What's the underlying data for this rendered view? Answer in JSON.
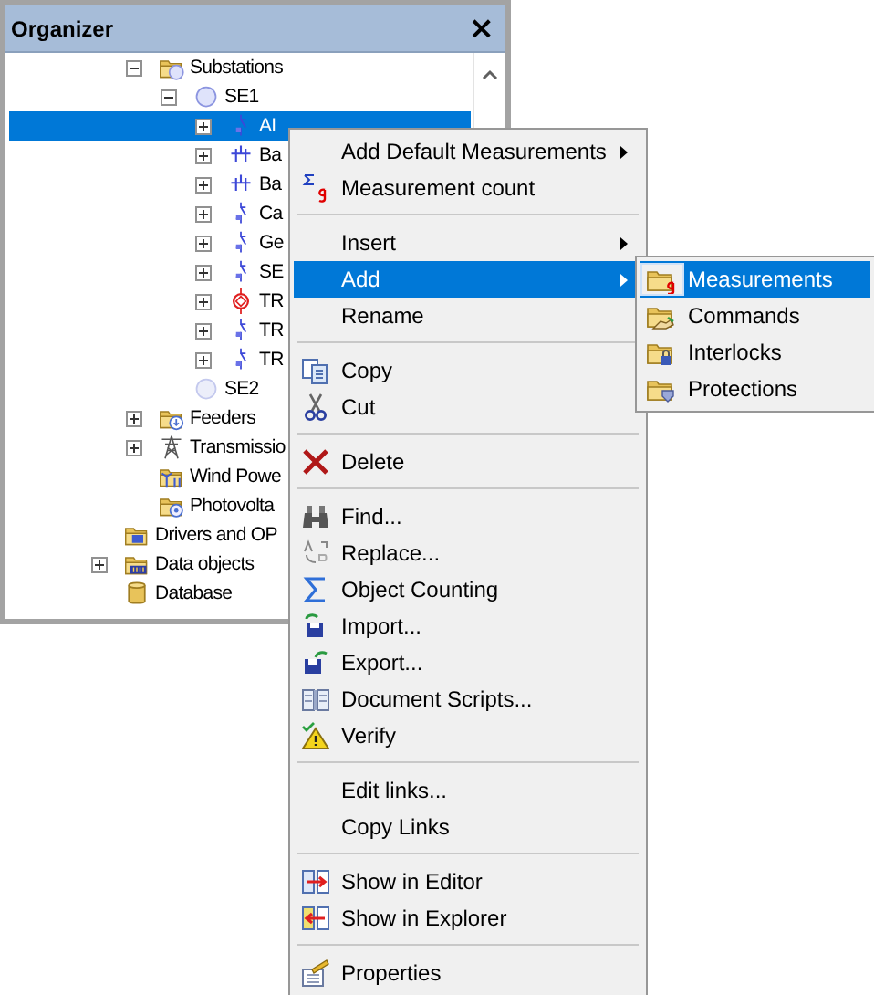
{
  "panel": {
    "title": "Organizer",
    "close": "×"
  },
  "tree": {
    "continued_branch": [
      {
        "label": "Substations",
        "kind": "station-folder",
        "expanded": true,
        "selected": false,
        "children": [
          {
            "label": "SE1",
            "kind": "station",
            "expanded": true,
            "selected": false,
            "children": [
              {
                "label": "AI",
                "kind": "switch",
                "expanded": false,
                "selected": true
              },
              {
                "label": "Ba",
                "kind": "busbar",
                "expanded": false,
                "selected": false
              },
              {
                "label": "Ba",
                "kind": "busbar",
                "expanded": false,
                "selected": false
              },
              {
                "label": "Ca",
                "kind": "switch",
                "expanded": false,
                "selected": false
              },
              {
                "label": "Ge",
                "kind": "switch",
                "expanded": false,
                "selected": false
              },
              {
                "label": "SE",
                "kind": "switch",
                "expanded": false,
                "selected": false
              },
              {
                "label": "TR",
                "kind": "transformer",
                "expanded": false,
                "selected": false
              },
              {
                "label": "TR",
                "kind": "switch",
                "expanded": false,
                "selected": false
              },
              {
                "label": "TR",
                "kind": "switch",
                "expanded": false,
                "selected": false
              }
            ]
          },
          {
            "label": "SE2",
            "kind": "station-pale",
            "selected": false
          }
        ]
      },
      {
        "label": "Feeders",
        "kind": "feeder-folder",
        "expanded": false,
        "selected": false
      },
      {
        "label": "Transmissio",
        "kind": "tower",
        "expanded": false,
        "selected": false
      },
      {
        "label": "Wind Powe",
        "kind": "wind-folder",
        "selected": false
      },
      {
        "label": "Photovolta",
        "kind": "pv-folder",
        "selected": false
      }
    ],
    "items": [
      {
        "label": "Drivers and OP",
        "kind": "drivers-folder",
        "selected": false
      },
      {
        "label": "Data objects",
        "kind": "data-folder",
        "expanded": false,
        "selected": false
      },
      {
        "label": "Database",
        "kind": "database",
        "selected": false
      }
    ]
  },
  "context_menu": {
    "items": [
      {
        "kind": "plain",
        "label": "Add Default Measurements",
        "submenu": true,
        "selected": false
      },
      {
        "kind": "sigma-g",
        "label": "Measurement count",
        "submenu": false,
        "selected": false
      },
      {
        "kind": "separator"
      },
      {
        "kind": "plain",
        "label": "Insert",
        "submenu": true,
        "selected": false
      },
      {
        "kind": "plain",
        "label": "Add",
        "submenu": true,
        "selected": true
      },
      {
        "kind": "plain",
        "label": "Rename",
        "submenu": false,
        "selected": false
      },
      {
        "kind": "separator"
      },
      {
        "kind": "copy",
        "label": "Copy",
        "submenu": false,
        "selected": false
      },
      {
        "kind": "scissors",
        "label": "Cut",
        "submenu": false,
        "selected": false
      },
      {
        "kind": "separator"
      },
      {
        "kind": "cross",
        "label": "Delete",
        "submenu": false,
        "selected": false
      },
      {
        "kind": "separator"
      },
      {
        "kind": "binoculars",
        "label": "Find...",
        "submenu": false,
        "selected": false
      },
      {
        "kind": "replace",
        "label": "Replace...",
        "submenu": false,
        "selected": false
      },
      {
        "kind": "sigma",
        "label": "Object Counting",
        "submenu": false,
        "selected": false
      },
      {
        "kind": "import",
        "label": "Import...",
        "submenu": false,
        "selected": false
      },
      {
        "kind": "export",
        "label": "Export...",
        "submenu": false,
        "selected": false
      },
      {
        "kind": "book",
        "label": "Document Scripts...",
        "submenu": false,
        "selected": false
      },
      {
        "kind": "warning",
        "label": "Verify",
        "submenu": false,
        "selected": false
      },
      {
        "kind": "separator"
      },
      {
        "kind": "plain",
        "label": "Edit links...",
        "submenu": false,
        "selected": false
      },
      {
        "kind": "plain",
        "label": "Copy Links",
        "submenu": false,
        "selected": false
      },
      {
        "kind": "separator"
      },
      {
        "kind": "to-editor",
        "label": "Show in Editor",
        "submenu": false,
        "selected": false
      },
      {
        "kind": "to-explorer",
        "label": "Show in Explorer",
        "submenu": false,
        "selected": false
      },
      {
        "kind": "separator"
      },
      {
        "kind": "properties",
        "label": "Properties",
        "submenu": false,
        "selected": false
      }
    ]
  },
  "submenu": {
    "items": [
      {
        "kind": "folder-g",
        "label": "Measurements",
        "selected": true
      },
      {
        "kind": "folder-hand",
        "label": "Commands",
        "selected": false
      },
      {
        "kind": "folder-lock",
        "label": "Interlocks",
        "selected": false
      },
      {
        "kind": "folder-shield",
        "label": "Protections",
        "selected": false
      }
    ]
  }
}
